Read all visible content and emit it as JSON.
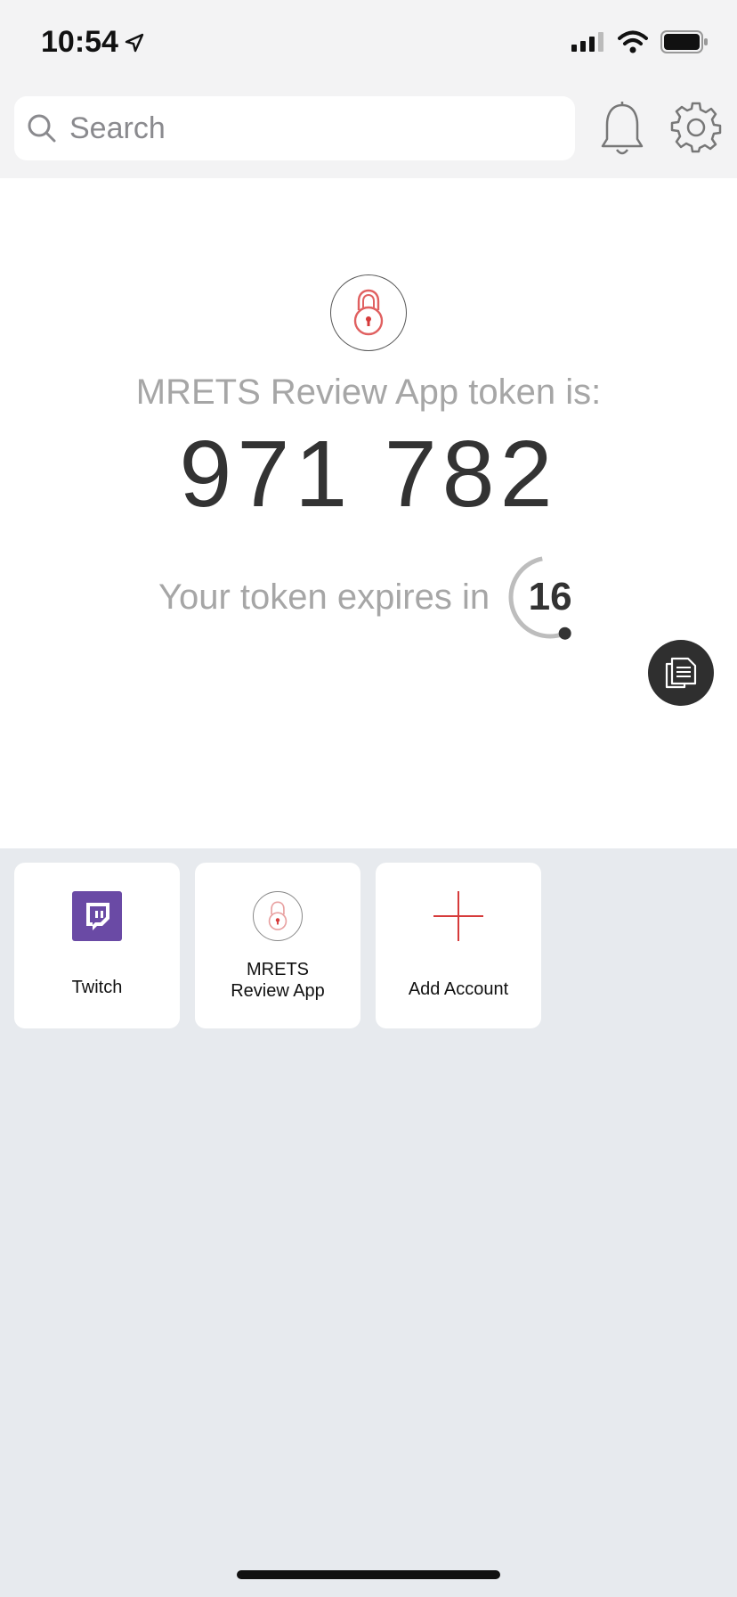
{
  "status_bar": {
    "time": "10:54"
  },
  "header": {
    "search_placeholder": "Search"
  },
  "token": {
    "label": "MRETS Review App token is:",
    "code": "971 782",
    "expires_label": "Your token expires in",
    "seconds_remaining": "16",
    "timer_progress": 0.53
  },
  "accounts": [
    {
      "name": "Twitch",
      "icon": "twitch-logo"
    },
    {
      "name_line1": "MRETS",
      "name_line2": "Review App",
      "icon": "lock-icon"
    },
    {
      "name": "Add Account",
      "icon": "plus-icon"
    }
  ],
  "colors": {
    "accent_red": "#d63b3b",
    "twitch_purple": "#6a4aa5",
    "dark": "#2f2f2f"
  }
}
